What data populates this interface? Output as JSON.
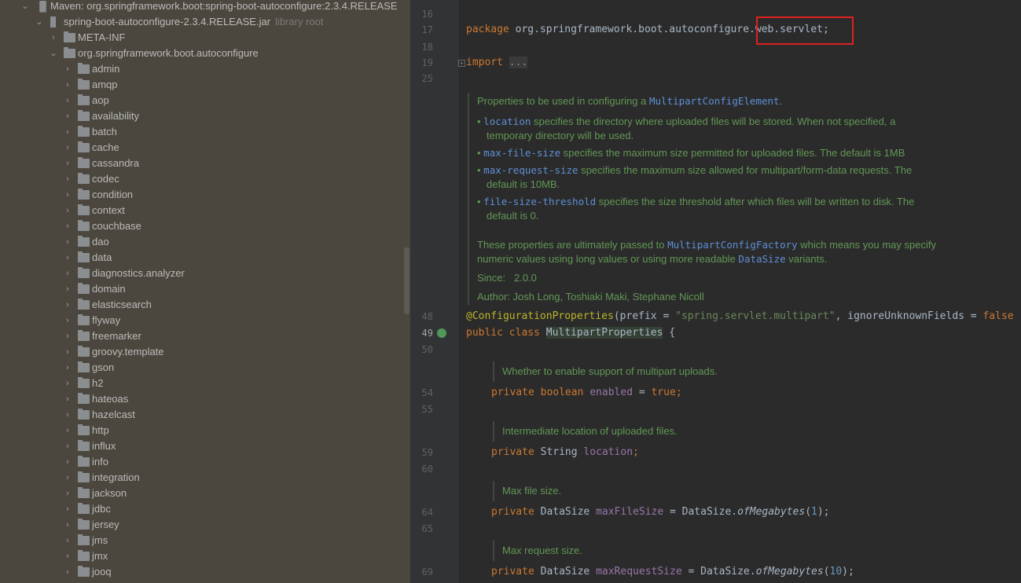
{
  "project_tree": {
    "maven_root": "Maven: org.springframework.boot:spring-boot-autoconfigure:2.3.4.RELEASE",
    "jar": "spring-boot-autoconfigure-2.3.4.RELEASE.jar",
    "jar_hint": "library root",
    "meta_inf": "META-INF",
    "package": "org.springframework.boot.autoconfigure",
    "packages": [
      "admin",
      "amqp",
      "aop",
      "availability",
      "batch",
      "cache",
      "cassandra",
      "codec",
      "condition",
      "context",
      "couchbase",
      "dao",
      "data",
      "diagnostics.analyzer",
      "domain",
      "elasticsearch",
      "flyway",
      "freemarker",
      "groovy.template",
      "gson",
      "h2",
      "hateoas",
      "hazelcast",
      "http",
      "influx",
      "info",
      "integration",
      "jackson",
      "jdbc",
      "jersey",
      "jms",
      "jmx",
      "jooq"
    ]
  },
  "editor": {
    "line_numbers": {
      "l16": "16",
      "l17": "17",
      "l18": "18",
      "l19": "19",
      "l25": "25",
      "l48": "48",
      "l49": "49",
      "l50": "50",
      "l54": "54",
      "l55": "55",
      "l59": "59",
      "l60": "60",
      "l64": "64",
      "l65": "65",
      "l69": "69"
    },
    "package_kw": "package",
    "package_name": "org.springframework.boot.autoconfigure",
    "package_suffix": ".web.servlet;",
    "import_kw": "import",
    "import_fold": "...",
    "javadoc": {
      "intro": "Properties to be used in configuring a ",
      "intro_link": "MultipartConfigElement",
      "intro_end": ".",
      "b1_code": "location",
      "b1_text": " specifies the directory where uploaded files will be stored. When not specified, a",
      "b1_text2": "temporary directory will be used.",
      "b2_code": "max-file-size",
      "b2_text": " specifies the maximum size permitted for uploaded files. The default is 1MB",
      "b3_code": "max-request-size",
      "b3_text": " specifies the maximum size allowed for multipart/form-data requests. The",
      "b3_text2": "default is 10MB.",
      "b4_code": "file-size-threshold",
      "b4_text": " specifies the size threshold after which files will be written to disk. The",
      "b4_text2": "default is 0.",
      "p1": "These properties are ultimately passed to ",
      "p1_link": "MultipartConfigFactory",
      "p1_mid": " which means you may specify",
      "p2": "numeric values using long values or using more readable ",
      "p2_link": "DataSize",
      "p2_end": " variants.",
      "since_label": "Since:",
      "since": "2.0.0",
      "author": "Author: Josh Long, Toshiaki Maki, Stephane Nicoll"
    },
    "annotation": "@ConfigurationProperties",
    "ann_prefix": "(prefix = ",
    "ann_str": "\"spring.servlet.multipart\"",
    "ann_mid": ", ignoreUnknownFields = ",
    "ann_false": "false",
    "class_kw": "public class ",
    "class_name": "MultipartProperties",
    "class_brace": " {",
    "doc_enabled": "Whether to enable support of multipart uploads.",
    "doc_location": "Intermediate location of uploaded files.",
    "doc_maxfile": "Max file size.",
    "doc_maxreq": "Max request size.",
    "f_enabled": {
      "mod": "private boolean ",
      "name": "enabled",
      "rest": " = ",
      "val": "true",
      ";": ";"
    },
    "f_location": {
      "mod": "private ",
      "type": "String ",
      "name": "location",
      "rest": ";"
    },
    "f_maxfile": {
      "mod": "private ",
      "type": "DataSize ",
      "name": "maxFileSize",
      "rest": " = DataSize.",
      "call": "ofMegabytes",
      "arg": "1",
      "end": ");"
    },
    "f_maxreq": {
      "mod": "private ",
      "type": "DataSize ",
      "name": "maxRequestSize",
      "rest": " = DataSize.",
      "call": "ofMegabytes",
      "arg": "10",
      "end": ");"
    }
  },
  "colors": {
    "keyword": "#cc7832",
    "annotation": "#bbb529",
    "string": "#6a8759",
    "field": "#9876aa",
    "javadoc": "#629755",
    "highlight_box": "#e02020"
  }
}
